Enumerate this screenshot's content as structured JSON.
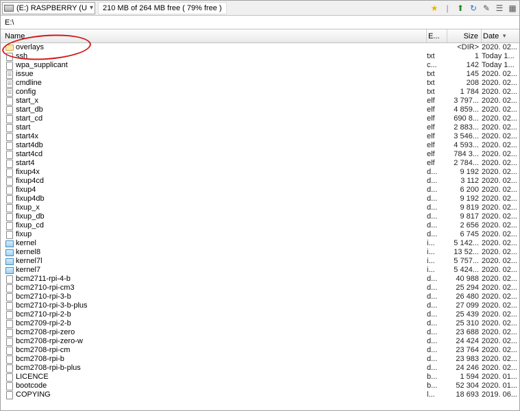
{
  "toolbar": {
    "drive_label": "(E:) RASPBERRY (U",
    "free_text": "210 MB of 264 MB free ( 79% free )",
    "icons": [
      "star-icon",
      "sep-icon",
      "up-icon",
      "refresh-icon",
      "wand-icon",
      "list-icon",
      "grid-icon"
    ]
  },
  "path": "E:\\",
  "headers": {
    "name": "Name",
    "ext": "E...",
    "size": "Size",
    "date": "Date"
  },
  "rows": [
    {
      "icon": "folder",
      "name": "overlays",
      "ext": "",
      "size": "<DIR>",
      "date": "2020. 02..."
    },
    {
      "icon": "file",
      "name": "ssh",
      "ext": "txt",
      "size": "1",
      "date": "Today 1..."
    },
    {
      "icon": "file",
      "name": "wpa_supplicant",
      "ext": "c...",
      "size": "142",
      "date": "Today 1..."
    },
    {
      "icon": "txt",
      "name": "issue",
      "ext": "txt",
      "size": "145",
      "date": "2020. 02..."
    },
    {
      "icon": "txt",
      "name": "cmdline",
      "ext": "txt",
      "size": "208",
      "date": "2020. 02..."
    },
    {
      "icon": "txt",
      "name": "config",
      "ext": "txt",
      "size": "1 784",
      "date": "2020. 02..."
    },
    {
      "icon": "file",
      "name": "start_x",
      "ext": "elf",
      "size": "3 797...",
      "date": "2020. 02..."
    },
    {
      "icon": "file",
      "name": "start_db",
      "ext": "elf",
      "size": "4 859...",
      "date": "2020. 02..."
    },
    {
      "icon": "file",
      "name": "start_cd",
      "ext": "elf",
      "size": "690 8...",
      "date": "2020. 02..."
    },
    {
      "icon": "file",
      "name": "start",
      "ext": "elf",
      "size": "2 883...",
      "date": "2020. 02..."
    },
    {
      "icon": "file",
      "name": "start4x",
      "ext": "elf",
      "size": "3 546...",
      "date": "2020. 02..."
    },
    {
      "icon": "file",
      "name": "start4db",
      "ext": "elf",
      "size": "4 593...",
      "date": "2020. 02..."
    },
    {
      "icon": "file",
      "name": "start4cd",
      "ext": "elf",
      "size": "784 3...",
      "date": "2020. 02..."
    },
    {
      "icon": "file",
      "name": "start4",
      "ext": "elf",
      "size": "2 784...",
      "date": "2020. 02..."
    },
    {
      "icon": "file",
      "name": "fixup4x",
      "ext": "d...",
      "size": "9 192",
      "date": "2020. 02..."
    },
    {
      "icon": "file",
      "name": "fixup4cd",
      "ext": "d...",
      "size": "3 112",
      "date": "2020. 02..."
    },
    {
      "icon": "file",
      "name": "fixup4",
      "ext": "d...",
      "size": "6 200",
      "date": "2020. 02..."
    },
    {
      "icon": "file",
      "name": "fixup4db",
      "ext": "d...",
      "size": "9 192",
      "date": "2020. 02..."
    },
    {
      "icon": "file",
      "name": "fixup_x",
      "ext": "d...",
      "size": "9 819",
      "date": "2020. 02..."
    },
    {
      "icon": "file",
      "name": "fixup_db",
      "ext": "d...",
      "size": "9 817",
      "date": "2020. 02..."
    },
    {
      "icon": "file",
      "name": "fixup_cd",
      "ext": "d...",
      "size": "2 656",
      "date": "2020. 02..."
    },
    {
      "icon": "file",
      "name": "fixup",
      "ext": "d...",
      "size": "6 745",
      "date": "2020. 02..."
    },
    {
      "icon": "img",
      "name": "kernel",
      "ext": "i...",
      "size": "5 142...",
      "date": "2020. 02..."
    },
    {
      "icon": "img",
      "name": "kernel8",
      "ext": "i...",
      "size": "13 52...",
      "date": "2020. 02..."
    },
    {
      "icon": "img",
      "name": "kernel7l",
      "ext": "i...",
      "size": "5 757...",
      "date": "2020. 02..."
    },
    {
      "icon": "img",
      "name": "kernel7",
      "ext": "i...",
      "size": "5 424...",
      "date": "2020. 02..."
    },
    {
      "icon": "file",
      "name": "bcm2711-rpi-4-b",
      "ext": "d...",
      "size": "40 988",
      "date": "2020. 02..."
    },
    {
      "icon": "file",
      "name": "bcm2710-rpi-cm3",
      "ext": "d...",
      "size": "25 294",
      "date": "2020. 02..."
    },
    {
      "icon": "file",
      "name": "bcm2710-rpi-3-b",
      "ext": "d...",
      "size": "26 480",
      "date": "2020. 02..."
    },
    {
      "icon": "file",
      "name": "bcm2710-rpi-3-b-plus",
      "ext": "d...",
      "size": "27 099",
      "date": "2020. 02..."
    },
    {
      "icon": "file",
      "name": "bcm2710-rpi-2-b",
      "ext": "d...",
      "size": "25 439",
      "date": "2020. 02..."
    },
    {
      "icon": "file",
      "name": "bcm2709-rpi-2-b",
      "ext": "d...",
      "size": "25 310",
      "date": "2020. 02..."
    },
    {
      "icon": "file",
      "name": "bcm2708-rpi-zero",
      "ext": "d...",
      "size": "23 688",
      "date": "2020. 02..."
    },
    {
      "icon": "file",
      "name": "bcm2708-rpi-zero-w",
      "ext": "d...",
      "size": "24 424",
      "date": "2020. 02..."
    },
    {
      "icon": "file",
      "name": "bcm2708-rpi-cm",
      "ext": "d...",
      "size": "23 764",
      "date": "2020. 02..."
    },
    {
      "icon": "file",
      "name": "bcm2708-rpi-b",
      "ext": "d...",
      "size": "23 983",
      "date": "2020. 02..."
    },
    {
      "icon": "file",
      "name": "bcm2708-rpi-b-plus",
      "ext": "d...",
      "size": "24 246",
      "date": "2020. 02..."
    },
    {
      "icon": "file",
      "name": "LICENCE",
      "ext": "b...",
      "size": "1 594",
      "date": "2020. 01..."
    },
    {
      "icon": "file",
      "name": "bootcode",
      "ext": "b...",
      "size": "52 304",
      "date": "2020. 01..."
    },
    {
      "icon": "file",
      "name": "COPYING",
      "ext": "l...",
      "size": "18 693",
      "date": "2019. 06..."
    }
  ]
}
